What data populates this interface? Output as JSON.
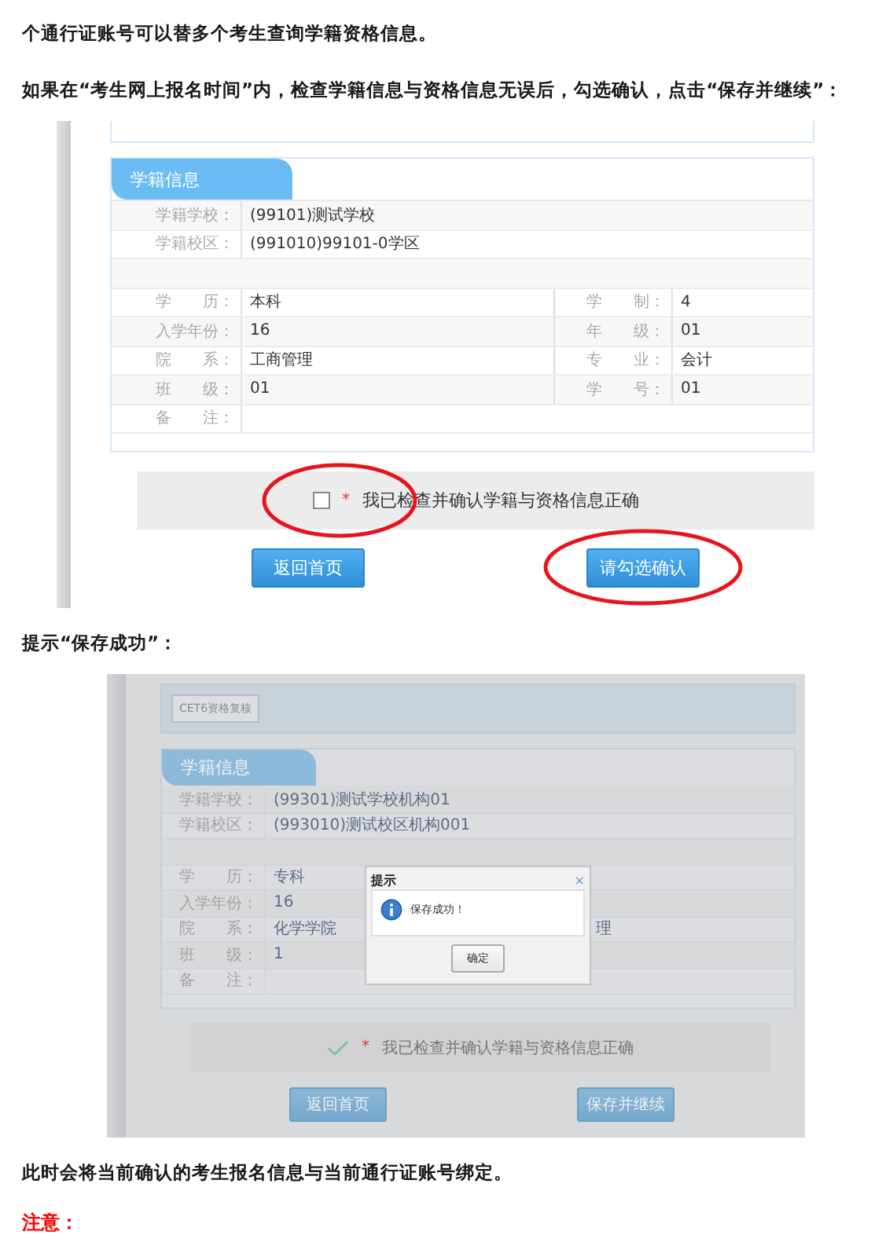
{
  "paragraphs_before": [
    {
      "text": "个通行证账号可以替多个考生查询学籍资格信息。",
      "kind": "body"
    },
    {
      "text": "如果在“考生网上报名时间”内，检查学籍信息与资格信息无误后，勾选确认，点击“保存并继续”：",
      "kind": "body"
    }
  ],
  "screenshot_1": {
    "section_title": "学籍信息",
    "rows": [
      {
        "label": "学籍学校：",
        "value": "(99101)测试学校"
      },
      {
        "label": "学籍校区：",
        "value": "(991010)99101-0学区"
      }
    ],
    "grid_rows": [
      {
        "left_label": "学　　历：",
        "left_value": "本科",
        "right_label": "学　　制：",
        "right_value": "4"
      },
      {
        "left_label": "入学年份：",
        "left_value": "16",
        "right_label": "年　　级：",
        "right_value": "01"
      },
      {
        "left_label": "院　　系：",
        "left_value": "工商管理",
        "right_label": "专　　业：",
        "right_value": "会计"
      },
      {
        "left_label": "班　　级：",
        "left_value": "01",
        "right_label": "学　　号：",
        "right_value": "01"
      }
    ],
    "remarks_label": "备　　注：",
    "confirm": {
      "checked": false,
      "required_mark": "*",
      "text": "我已检查并确认学籍与资格信息正确",
      "highlighted": true
    },
    "buttons": [
      {
        "label": "返回首页"
      },
      {
        "label": "请勾选确认",
        "highlighted": true
      }
    ]
  },
  "caption": {
    "text": "提示“保存成功”：",
    "kind": "body"
  },
  "screenshot_2": {
    "panel_button": "CET6资格复核",
    "section_title": "学籍信息",
    "dimmed": true,
    "rows": [
      {
        "label": "学籍学校：",
        "value": "(99301)测试学校机构01"
      },
      {
        "label": "学籍校区：",
        "value": "(993010)测试校区机构001"
      }
    ],
    "grid_rows": [
      {
        "left_label": "学　　历：",
        "left_value": "专科"
      },
      {
        "left_label": "入学年份：",
        "left_value": "16"
      },
      {
        "left_label": "院　　系：",
        "left_value": "化学学院",
        "right_value": "理"
      },
      {
        "left_label": "班　　级：",
        "left_value": "1"
      }
    ],
    "remarks_label": "备　　注：",
    "confirm": {
      "checked": true,
      "required_mark": "*",
      "text": "我已检查并确认学籍与资格信息正确"
    },
    "buttons": [
      {
        "label": "返回首页"
      },
      {
        "label": "保存并继续"
      }
    ],
    "dialog": {
      "title": "提示",
      "close": "×",
      "message": "保存成功！",
      "button": "确定"
    }
  },
  "paragraphs_after": [
    {
      "text": "此时会将当前确认的考生报名信息与当前通行证账号绑定。",
      "kind": "body"
    },
    {
      "text": "注意：",
      "kind": "warning"
    }
  ]
}
